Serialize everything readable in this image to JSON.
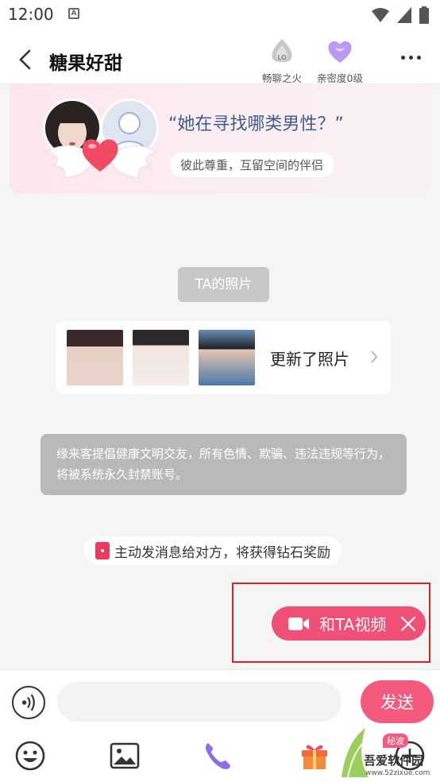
{
  "status_bar": {
    "time": "12:00",
    "notification_letter": "A"
  },
  "header": {
    "title": "糖果好甜",
    "badges": [
      {
        "icon": "fire-level-icon",
        "label": "畅聊之火",
        "level_text": "LO"
      },
      {
        "icon": "heart-intimacy-icon",
        "label": "亲密度0级"
      }
    ]
  },
  "match_card": {
    "question": "“她在寻找哪类男性？”",
    "tag": "彼此尊重，互留空间的伴侣"
  },
  "photos_section": {
    "label": "TA的照片",
    "update_text": "更新了照片",
    "thumbnail_count": 3
  },
  "system_notice": "缘来客提倡健康文明交友，所有色情、欺骗、违法违规等行为，将被系统永久封禁账号。",
  "reward_tip": "主动发消息给对方，将获得钻石奖励",
  "video_call": {
    "label": "和TA视频"
  },
  "composer": {
    "input_value": "",
    "send_label": "发送"
  },
  "toolbar": {
    "items": [
      "emoji-icon",
      "image-icon",
      "phone-icon",
      "gift-icon",
      "add-icon"
    ],
    "secret_badge": "秘波"
  },
  "watermark": {
    "title": "吾爱软件园",
    "url": "www.52zixue.com"
  },
  "colors": {
    "accent": "#f35a7e",
    "frame": "#e02020",
    "question": "#3b5d8c"
  }
}
